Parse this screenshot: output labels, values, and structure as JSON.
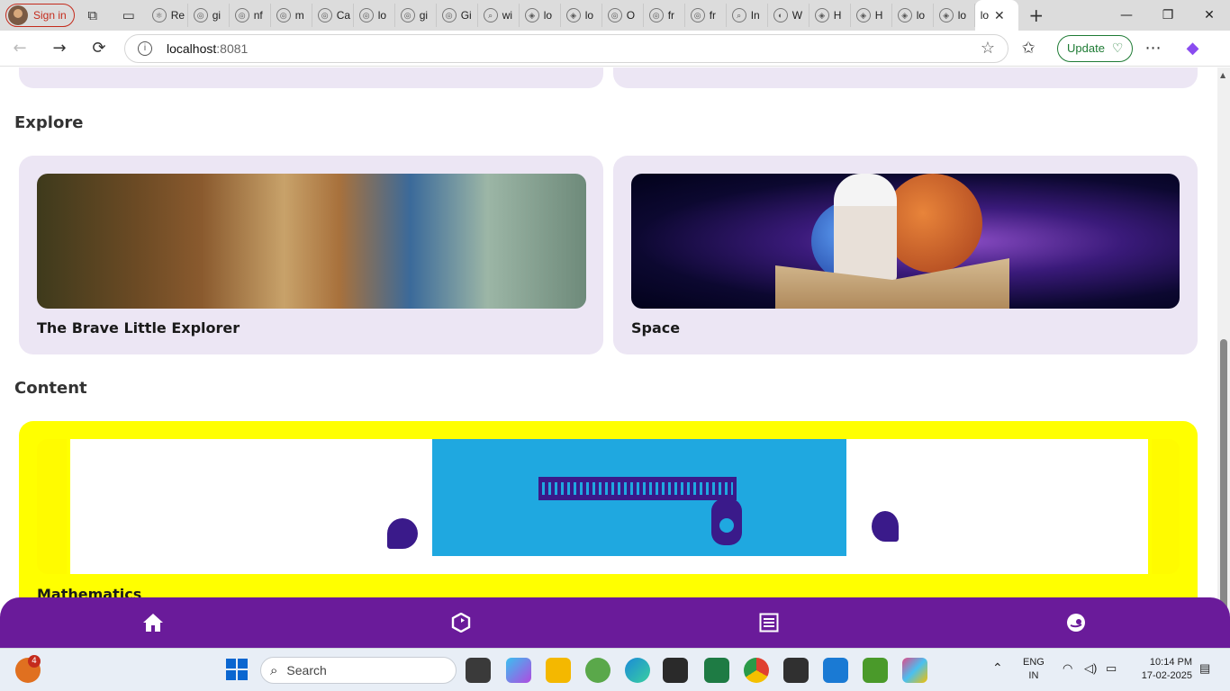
{
  "browser": {
    "signin_label": "Sign in",
    "tabs": [
      {
        "label": "Re",
        "icon": "react-icon"
      },
      {
        "label": "gi",
        "icon": "globe-icon"
      },
      {
        "label": "nf",
        "icon": "globe-icon"
      },
      {
        "label": "m",
        "icon": "globe-icon"
      },
      {
        "label": "Ca",
        "icon": "globe-icon"
      },
      {
        "label": "lo",
        "icon": "globe-icon"
      },
      {
        "label": "gi",
        "icon": "globe-icon"
      },
      {
        "label": "Gi",
        "icon": "globe-icon"
      },
      {
        "label": "wi",
        "icon": "search-icon"
      },
      {
        "label": "lo",
        "icon": "app-icon"
      },
      {
        "label": "lo",
        "icon": "app-icon"
      },
      {
        "label": "O",
        "icon": "globe-icon"
      },
      {
        "label": "fr",
        "icon": "globe-icon"
      },
      {
        "label": "fr",
        "icon": "globe-icon"
      },
      {
        "label": "In",
        "icon": "search-icon"
      },
      {
        "label": "W",
        "icon": "edge-icon"
      },
      {
        "label": "H",
        "icon": "app-icon"
      },
      {
        "label": "H",
        "icon": "app-icon"
      },
      {
        "label": "lo",
        "icon": "app-icon"
      },
      {
        "label": "lo",
        "icon": "app-icon"
      }
    ],
    "active_tab_label": "lo",
    "url_host": "localhost",
    "url_port": ":8081",
    "update_label": "Update"
  },
  "page": {
    "explore_title": "Explore",
    "explore_cards": [
      {
        "label": "The Brave Little Explorer"
      },
      {
        "label": "Space"
      }
    ],
    "content_title": "Content",
    "content_cards": [
      {
        "label": "Mathematics"
      }
    ]
  },
  "bottom_nav": {
    "items": [
      "home-icon",
      "cube-icon",
      "list-icon",
      "face-icon"
    ]
  },
  "taskbar": {
    "search_placeholder": "Search",
    "weather_badge": "4",
    "lang_line1": "ENG",
    "lang_line2": "IN",
    "time": "10:14 PM",
    "date": "17-02-2025"
  },
  "colors": {
    "nav_purple": "#6a1b9a",
    "card_lavender": "#ece6f4",
    "content_yellow": "#ffff00"
  }
}
